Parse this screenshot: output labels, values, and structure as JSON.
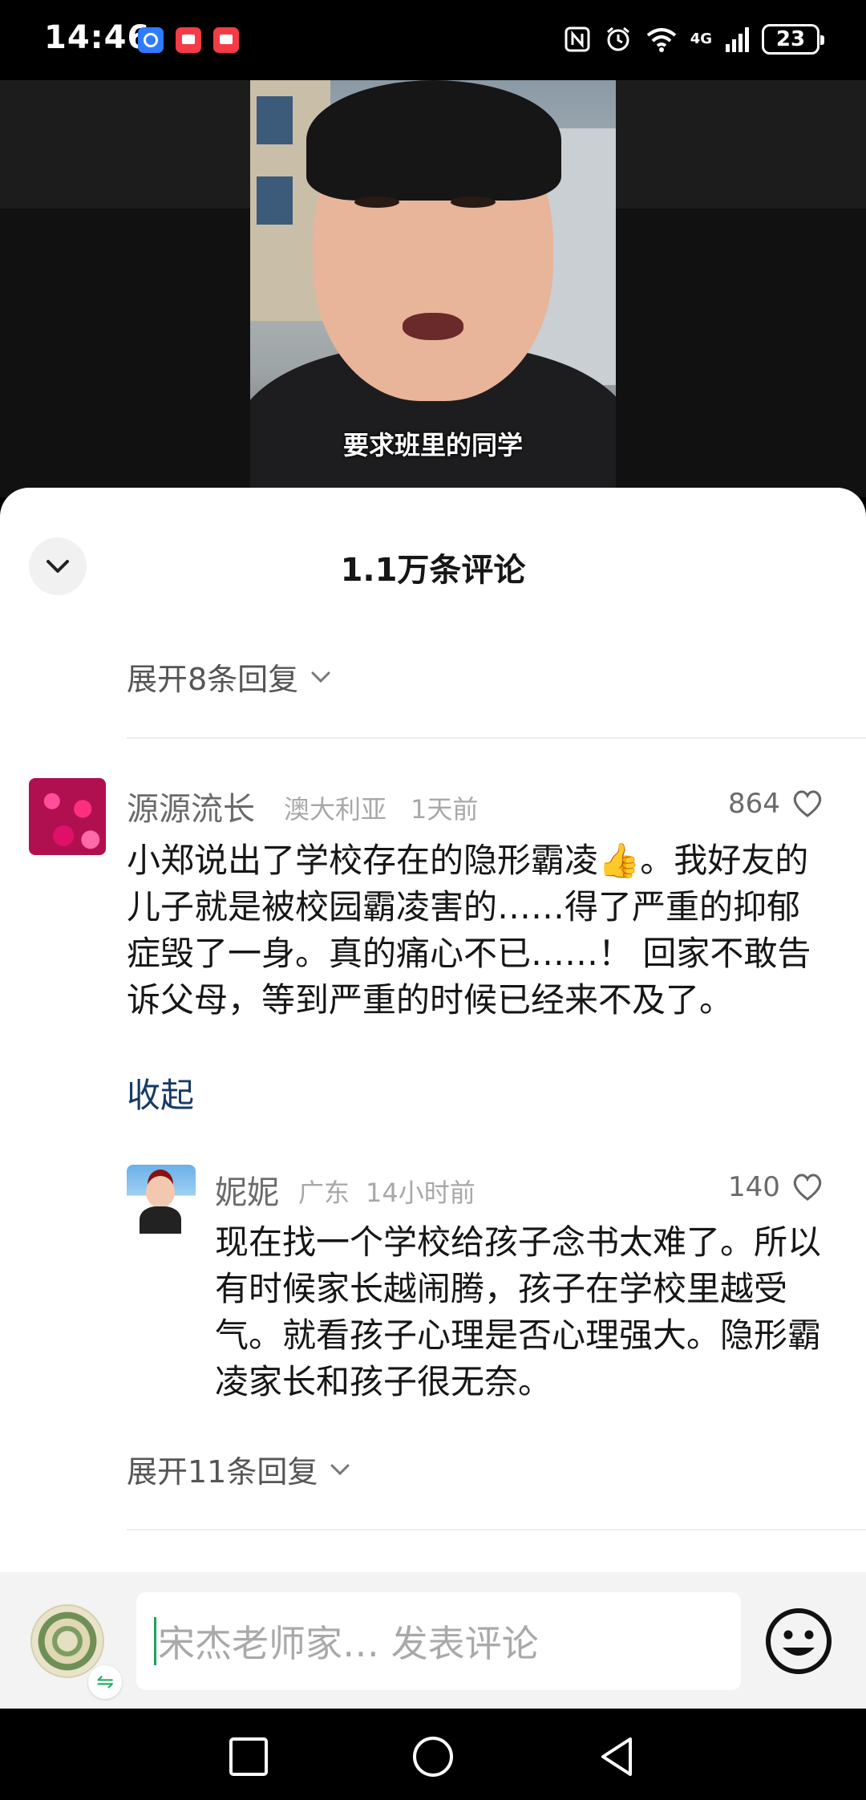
{
  "status_bar": {
    "time": "14:46",
    "icons": [
      "nfc-icon",
      "alarm-icon",
      "wifi-icon",
      "signal-icon"
    ],
    "network": "4G",
    "battery": "23"
  },
  "video": {
    "subtitle": "要求班里的同学"
  },
  "comments_sheet": {
    "title": "1.1万条评论",
    "expand_top": "展开8条回复",
    "comments": [
      {
        "user": "源源流长",
        "location": "澳大利亚",
        "time": "1天前",
        "likes": "864",
        "text": "小郑说出了学校存在的隐形霸凌👍。我好友的儿子就是被校园霸凌害的……得了严重的抑郁症毁了一身。真的痛心不已……！ 回家不敢告诉父母，等到严重的时候已经来不及了。",
        "fold_label": "收起"
      }
    ],
    "replies": [
      {
        "user": "妮妮",
        "location": "广东",
        "time": "14小时前",
        "likes": "140",
        "text": "现在找一个学校给孩子念书太难了。所以有时候家长越闹腾，孩子在学校里越受气。就看孩子心理是否心理强大。隐形霸凌家长和孩子很无奈。"
      }
    ],
    "expand_bottom": "展开11条回复"
  },
  "input_bar": {
    "placeholder": "宋杰老师家… 发表评论"
  },
  "colors": {
    "link": "#163a66",
    "caret": "#1aa35a"
  }
}
